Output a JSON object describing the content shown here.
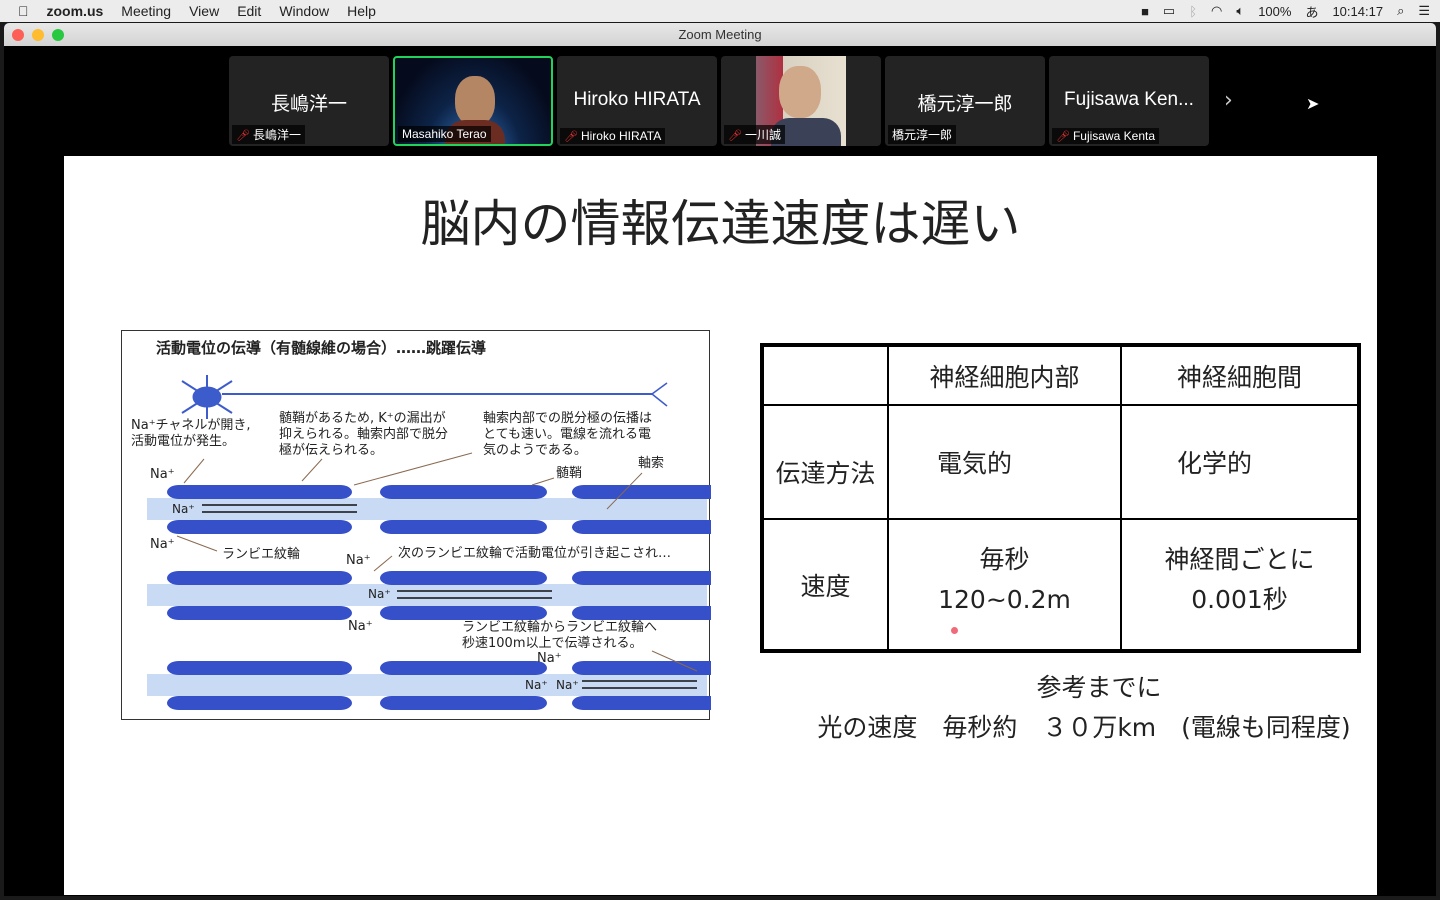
{
  "menubar": {
    "app": "zoom.us",
    "items": [
      "Meeting",
      "View",
      "Edit",
      "Window",
      "Help"
    ],
    "battery": "100%",
    "ime": "あ",
    "clock": "10:14:17"
  },
  "window": {
    "title": "Zoom Meeting"
  },
  "participants": [
    {
      "display": "長嶋洋一",
      "label": "長嶋洋一",
      "muted": true,
      "video": false
    },
    {
      "display": "",
      "label": "Masahiko Terao",
      "muted": false,
      "video": true,
      "active": true
    },
    {
      "display": "Hiroko HIRATA",
      "label": "Hiroko HIRATA",
      "muted": true,
      "video": false
    },
    {
      "display": "",
      "label": "一川誠",
      "muted": true,
      "video": true
    },
    {
      "display": "橋元淳一郎",
      "label": "橋元淳一郎",
      "muted": false,
      "video": false
    },
    {
      "display": "Fujisawa Ken...",
      "label": "Fujisawa Kenta",
      "muted": true,
      "video": false
    }
  ],
  "slide": {
    "title": "脳内の情報伝達速度は遅い",
    "diagram": {
      "title": "活動電位の伝導（有髄線維の場合）……跳躍伝導",
      "note1": [
        "Na⁺チャネルが開き,",
        "活動電位が発生。"
      ],
      "note2": [
        "髄鞘があるため, K⁺の漏出が",
        "抑えられる。軸索内部で脱分",
        "極が伝えられる。"
      ],
      "note3": [
        "軸索内部での脱分極の伝播は",
        "とても速い。電線を流れる電",
        "気のようである。"
      ],
      "myelin": "髄鞘",
      "axon": "軸索",
      "ranvier": "ランビエ紋輪",
      "next": "次のランビエ紋輪で活動電位が引き起こされ…",
      "speed": [
        "ランビエ紋輪からランビエ紋輪へ",
        "秒速100m以上で伝導される。"
      ],
      "na": "Na⁺"
    },
    "table": {
      "headers": [
        "",
        "神経細胞内部",
        "神経細胞間"
      ],
      "rows": [
        {
          "label": "伝達方法",
          "cells": [
            "電気的",
            "化学的"
          ]
        },
        {
          "label": "速度",
          "cells": [
            [
              "毎秒",
              "120~0.2m"
            ],
            [
              "神経間ごとに",
              "0.001秒"
            ]
          ]
        }
      ]
    },
    "reference": {
      "line1": "参考までに",
      "line2": "光の速度　毎秒約　３０万km　(電線も同程度)"
    }
  }
}
